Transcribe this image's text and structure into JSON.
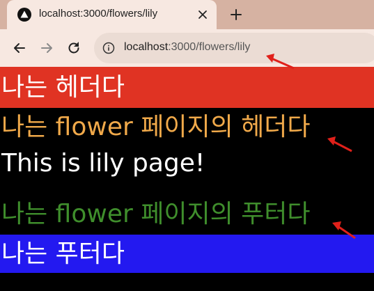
{
  "browser": {
    "tab_title": "localhost:3000/flowers/lily",
    "url_host": "localhost",
    "url_rest": ":3000/flowers/lily"
  },
  "page": {
    "header": "나는 헤더다",
    "flower_header": "나는 flower 페이지의 헤더다",
    "content": "This is lily page!",
    "flower_footer": "나는 flower 페이지의 푸터다",
    "footer": "나는 푸터다"
  },
  "colors": {
    "header_bg": "#e03323",
    "flower_header_text": "#f0a94a",
    "flower_footer_text": "#3f8e2c",
    "footer_bg": "#2319f0",
    "annotation_arrow": "#e0201a"
  },
  "icons": {
    "favicon": "triangle-logo-icon",
    "close": "close-icon",
    "new_tab": "plus-icon",
    "back": "arrow-left-icon",
    "forward": "arrow-right-icon",
    "reload": "reload-icon",
    "site_info": "info-icon"
  }
}
